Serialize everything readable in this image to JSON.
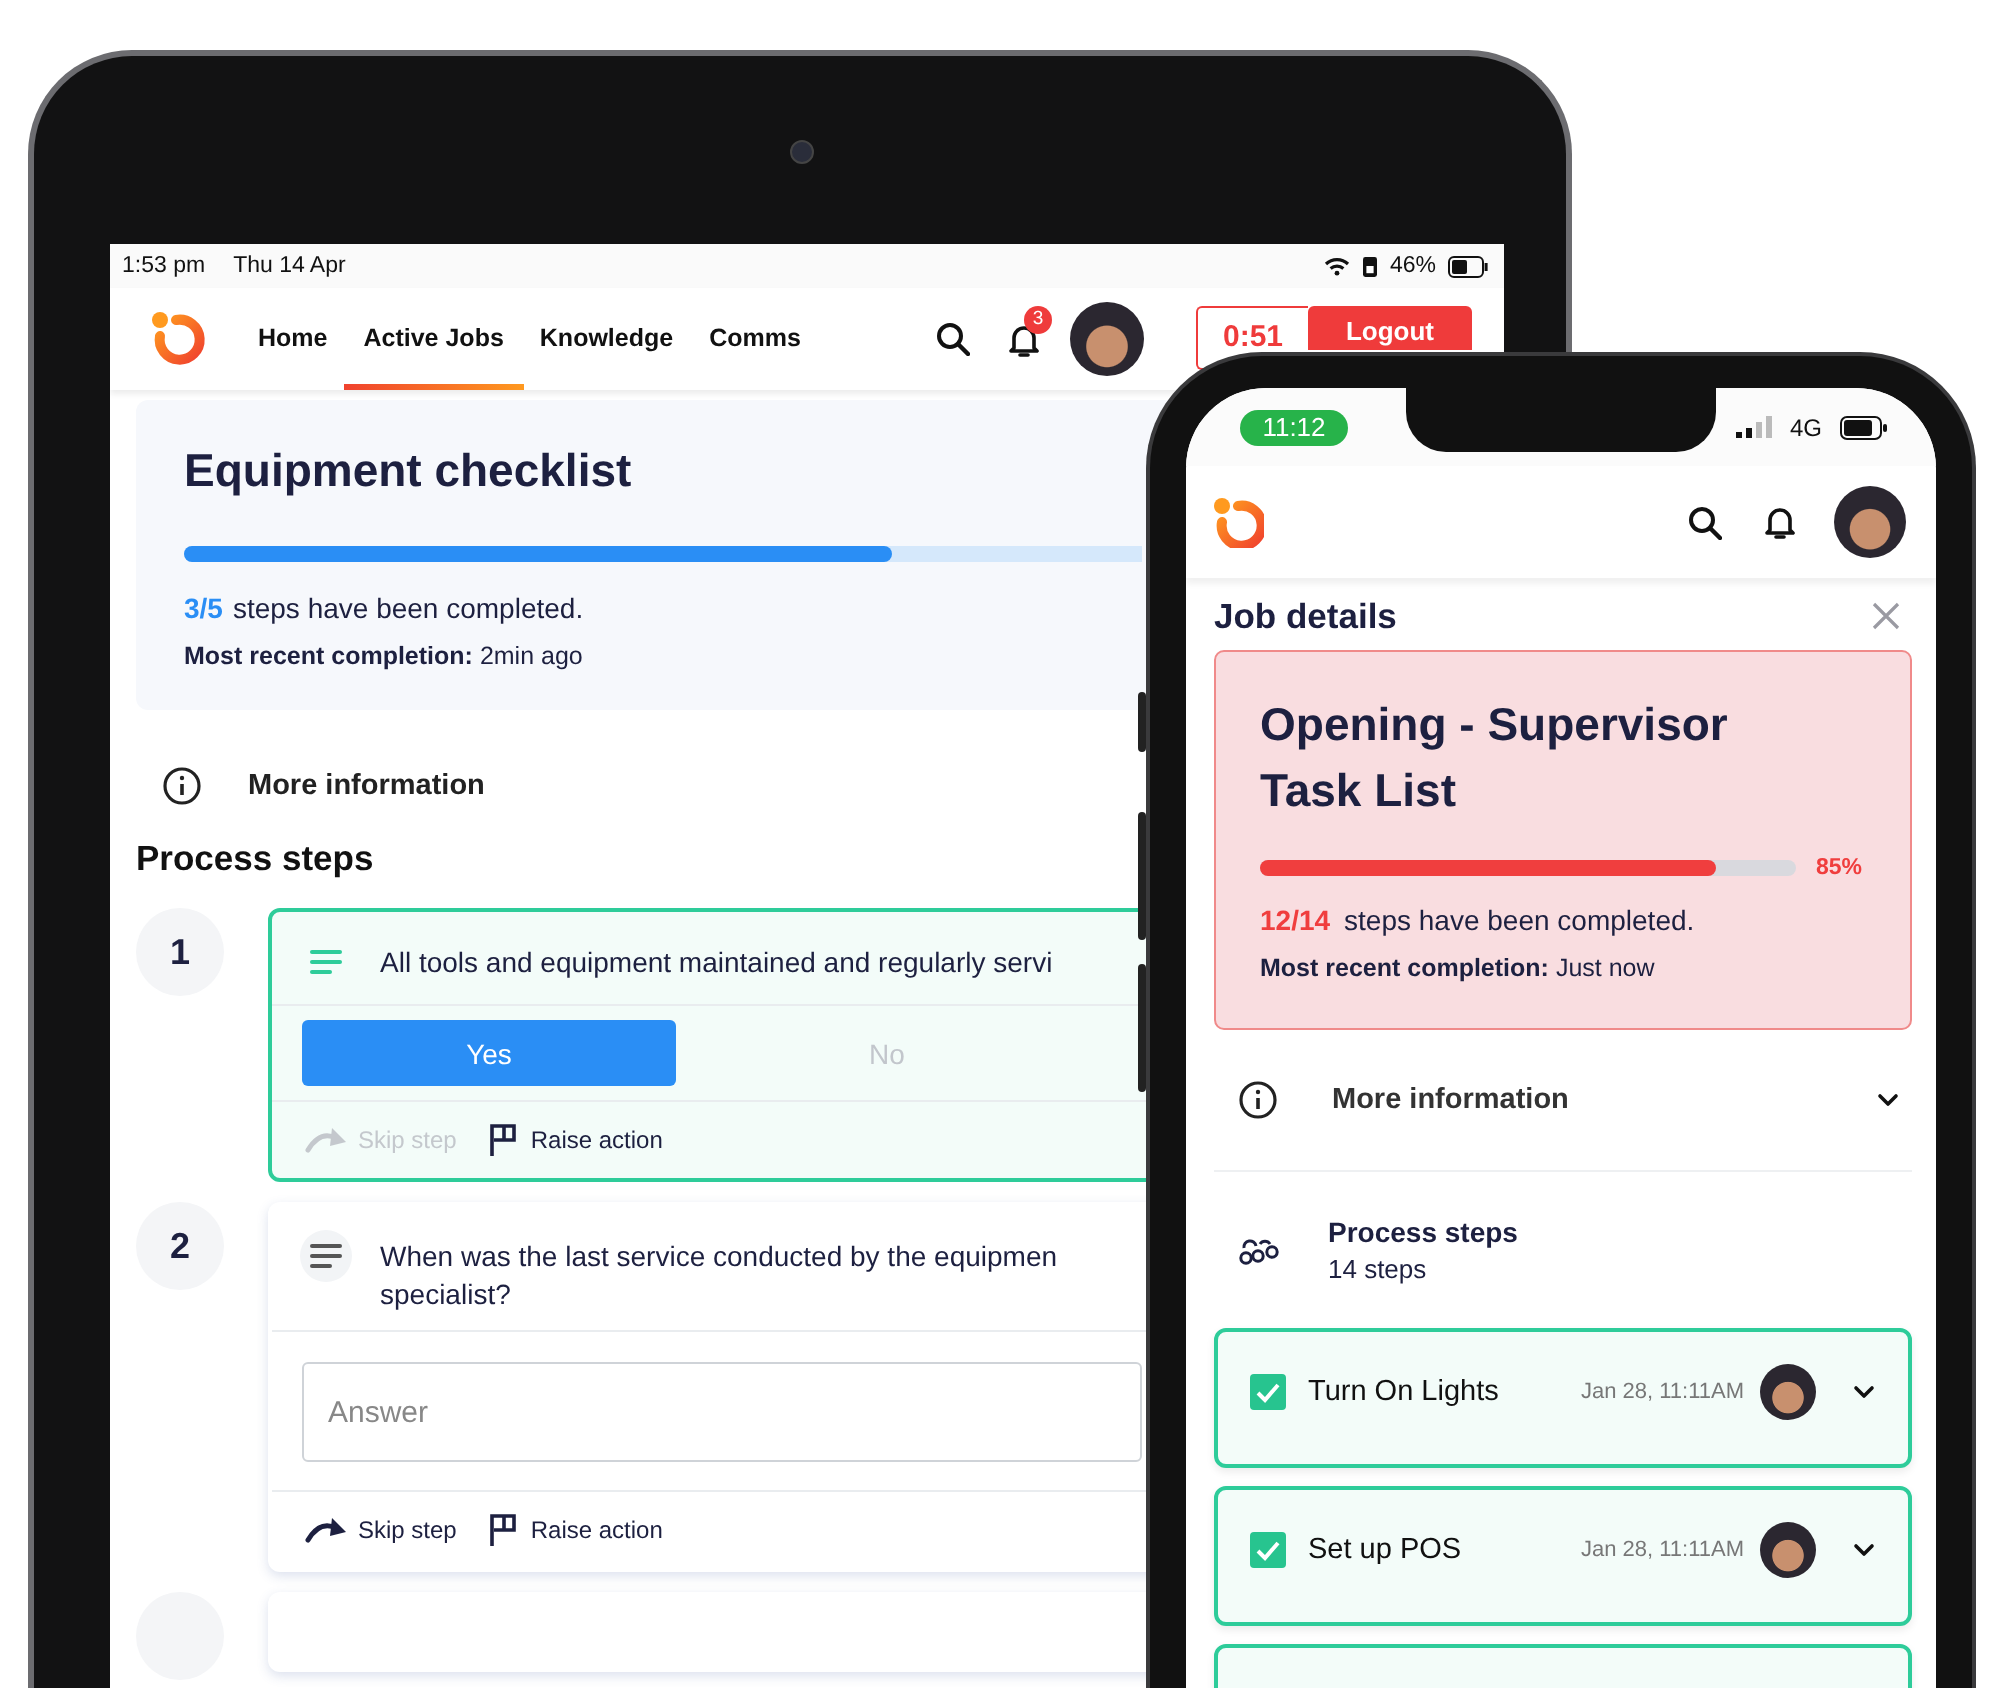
{
  "tablet": {
    "status_bar": {
      "time": "1:53 pm",
      "date": "Thu 14 Apr",
      "battery": "46%"
    },
    "nav": {
      "tabs": [
        {
          "label": "Home",
          "selected": false
        },
        {
          "label": "Active Jobs",
          "selected": true
        },
        {
          "label": "Knowledge",
          "selected": false
        },
        {
          "label": "Comms",
          "selected": false
        }
      ],
      "notification_count": "3",
      "timer": "0:51",
      "logout": "Logout"
    },
    "checklist": {
      "title": "Equipment checklist",
      "level": 0.74,
      "count": "3/5",
      "progress_text": "steps have been completed.",
      "recent": "**Most recent completion:** 2min ago"
    },
    "more_information": "More information",
    "process_steps_heading": "Process steps",
    "steps": [
      {
        "number": "1",
        "kind": "yes_no",
        "active": true,
        "lines": [
          "All tools and equipment maintained and regularly servi"
        ],
        "options": [
          {
            "label": "Yes",
            "selected": true
          },
          {
            "label": "No",
            "selected": false
          }
        ],
        "skip": {
          "label": "Skip step",
          "disabled": true
        },
        "raise": "Raise action"
      },
      {
        "number": "2",
        "kind": "text",
        "active": false,
        "lines": [
          "When was the last service conducted by the equipmen",
          "specialist?"
        ],
        "placeholder": "Answer",
        "skip": {
          "label": "Skip step",
          "disabled": false
        },
        "raise": "Raise action"
      }
    ]
  },
  "phone": {
    "status_bar": {
      "time": "11:12",
      "network": "4G"
    },
    "panel_title": "Job details",
    "job": {
      "title": "Opening - Supervisor Task List",
      "level": 0.85,
      "percent": "85%",
      "count": "12/14",
      "progress_text": "steps have been completed.",
      "recent": "**Most recent completion:** Just now"
    },
    "more_information": {
      "label": "More information",
      "expanded": false
    },
    "process_steps": {
      "title": "Process steps",
      "subtitle": "14 steps"
    },
    "steps": [
      {
        "title": "Turn On Lights",
        "checked": true,
        "date": "Jan 28, 11:11AM"
      },
      {
        "title": "Set up POS",
        "checked": true,
        "date": "Jan 28, 11:11AM"
      }
    ]
  }
}
